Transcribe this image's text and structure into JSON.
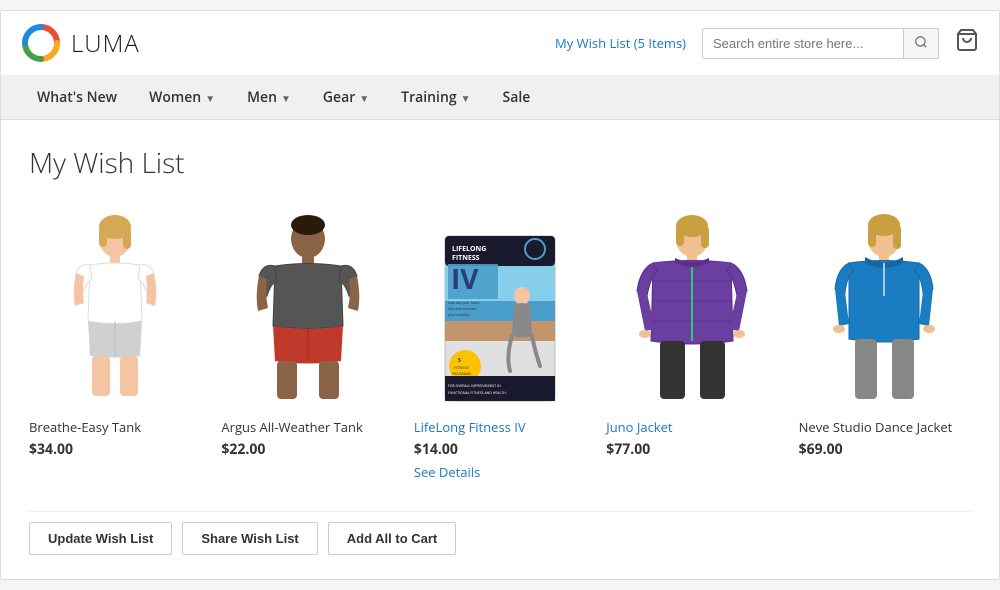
{
  "header": {
    "logo_text": "LUMA",
    "wishlist_text": "My Wish List (5 Items)",
    "search_placeholder": "Search entire store here...",
    "cart_icon": "🛒"
  },
  "nav": {
    "items": [
      {
        "label": "What's New",
        "has_dropdown": false
      },
      {
        "label": "Women",
        "has_dropdown": true
      },
      {
        "label": "Men",
        "has_dropdown": true
      },
      {
        "label": "Gear",
        "has_dropdown": true
      },
      {
        "label": "Training",
        "has_dropdown": true
      },
      {
        "label": "Sale",
        "has_dropdown": false
      }
    ]
  },
  "page": {
    "title": "My Wish List"
  },
  "products": [
    {
      "id": "breathe-easy-tank",
      "name": "Breathe-Easy Tank",
      "price": "$34.00",
      "has_link": false,
      "has_see_details": false,
      "figure_type": "woman-white-tank"
    },
    {
      "id": "argus-all-weather-tank",
      "name": "Argus All-Weather Tank",
      "price": "$22.00",
      "has_link": false,
      "has_see_details": false,
      "figure_type": "man-gray-tank"
    },
    {
      "id": "lifelong-fitness-iv",
      "name": "LifeLong Fitness IV",
      "price": "$14.00",
      "has_link": true,
      "has_see_details": true,
      "see_details_text": "See Details",
      "figure_type": "dvd"
    },
    {
      "id": "juno-jacket",
      "name": "Juno Jacket",
      "price": "$77.00",
      "has_link": true,
      "has_see_details": false,
      "figure_type": "woman-purple-jacket"
    },
    {
      "id": "neve-studio-dance-jacket",
      "name": "Neve Studio Dance Jacket",
      "price": "$69.00",
      "has_link": false,
      "has_see_details": false,
      "figure_type": "woman-blue-jacket"
    }
  ],
  "buttons": {
    "update_wish_list": "Update Wish List",
    "share_wish_list": "Share Wish List",
    "add_all_to_cart": "Add All to Cart"
  }
}
